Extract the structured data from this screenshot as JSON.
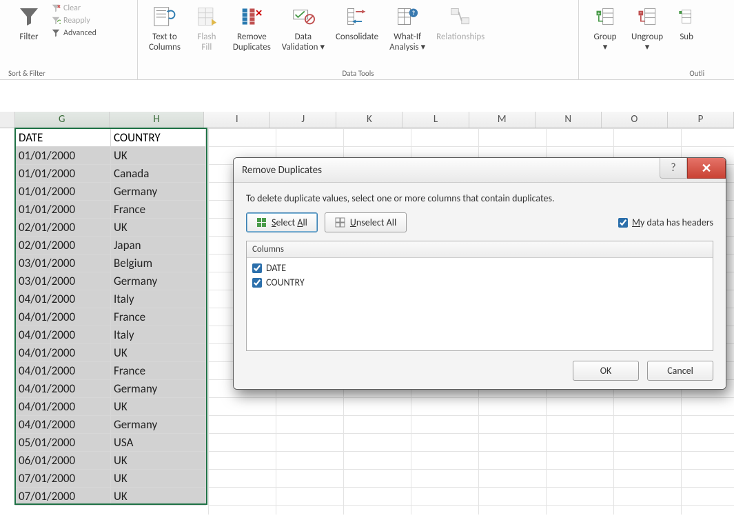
{
  "ribbon": {
    "filter": {
      "label": "Filter",
      "clear": "Clear",
      "reapply": "Reapply",
      "advanced": "Advanced",
      "group_label": "Sort & Filter"
    },
    "text_to_columns": "Text to\nColumns",
    "flash_fill": "Flash\nFill",
    "remove_duplicates": "Remove\nDuplicates",
    "data_validation": "Data\nValidation",
    "consolidate": "Consolidate",
    "whatif": "What-If\nAnalysis",
    "relationships": "Relationships",
    "data_tools_label": "Data Tools",
    "group": "Group",
    "ungroup": "Ungroup",
    "subtotal": "Sub",
    "outline_label": "Outli"
  },
  "columns": [
    "G",
    "H",
    "I",
    "J",
    "K",
    "L",
    "M",
    "N",
    "O",
    "P"
  ],
  "table": {
    "headers": [
      "DATE",
      "COUNTRY"
    ],
    "rows": [
      [
        "01/01/2000",
        "UK"
      ],
      [
        "01/01/2000",
        "Canada"
      ],
      [
        "01/01/2000",
        "Germany"
      ],
      [
        "01/01/2000",
        "France"
      ],
      [
        "02/01/2000",
        "UK"
      ],
      [
        "02/01/2000",
        "Japan"
      ],
      [
        "03/01/2000",
        "Belgium"
      ],
      [
        "03/01/2000",
        "Germany"
      ],
      [
        "04/01/2000",
        "Italy"
      ],
      [
        "04/01/2000",
        "France"
      ],
      [
        "04/01/2000",
        "Italy"
      ],
      [
        "04/01/2000",
        "UK"
      ],
      [
        "04/01/2000",
        "France"
      ],
      [
        "04/01/2000",
        "Germany"
      ],
      [
        "04/01/2000",
        "UK"
      ],
      [
        "04/01/2000",
        "Germany"
      ],
      [
        "05/01/2000",
        "USA"
      ],
      [
        "06/01/2000",
        "UK"
      ],
      [
        "07/01/2000",
        "UK"
      ],
      [
        "07/01/2000",
        "UK"
      ]
    ]
  },
  "dialog": {
    "title": "Remove Duplicates",
    "instruction": "To delete duplicate values, select one or more columns that contain duplicates.",
    "select_all": "Select All",
    "unselect_all": "Unselect All",
    "my_data_has_headers": "My data has headers",
    "columns_header": "Columns",
    "column_items": [
      "DATE",
      "COUNTRY"
    ],
    "ok": "OK",
    "cancel": "Cancel",
    "help": "?",
    "close": "✕"
  }
}
